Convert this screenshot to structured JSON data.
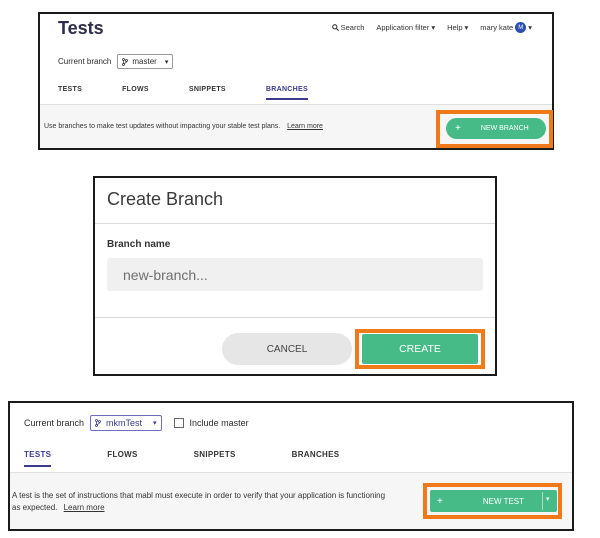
{
  "panel1": {
    "title": "Tests",
    "topnav": {
      "search": "Search",
      "app_filter": "Application filter",
      "help": "Help",
      "user": "mary kate",
      "avatar_letter": "M"
    },
    "branch_label": "Current branch",
    "branch_value": "master",
    "tabs": [
      "TESTS",
      "FLOWS",
      "SNIPPETS",
      "BRANCHES"
    ],
    "active_tab": "BRANCHES",
    "info_text": "Use branches to make test updates without impacting your stable test plans.",
    "learn_more": "Learn more",
    "new_branch_label": "NEW BRANCH",
    "plus": "+"
  },
  "panel2": {
    "title": "Create Branch",
    "field_label": "Branch name",
    "field_placeholder": "new-branch...",
    "cancel_label": "CANCEL",
    "create_label": "CREATE"
  },
  "panel3": {
    "branch_label": "Current branch",
    "branch_value": "mkmTest",
    "include_master": "Include master",
    "tabs": [
      "TESTS",
      "FLOWS",
      "SNIPPETS",
      "BRANCHES"
    ],
    "active_tab": "TESTS",
    "info_line1": "A test is the set of instructions that mabl must execute in order to verify that your application is functioning",
    "info_line2": "as expected.",
    "learn_more": "Learn more",
    "new_test_label": "NEW TEST",
    "plus": "+"
  },
  "colors": {
    "accent_green": "#46bb88",
    "highlight_orange": "#f07a1a",
    "nav_purple": "#3b3b8f"
  },
  "icons": [
    "search-icon",
    "caret-down-icon",
    "branch-icon",
    "avatar",
    "plus-icon",
    "checkbox"
  ]
}
